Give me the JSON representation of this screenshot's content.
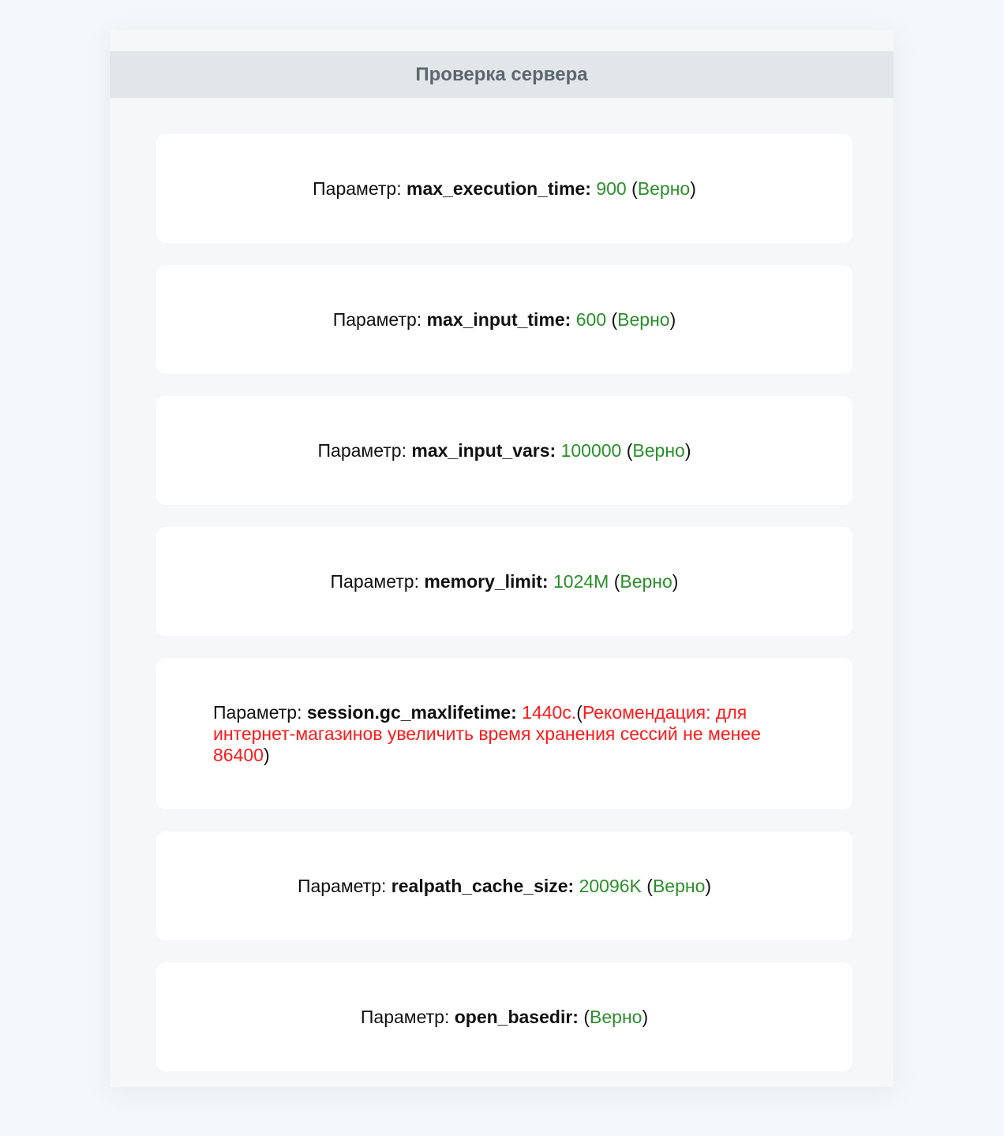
{
  "header": {
    "title": "Проверка сервера"
  },
  "checks": [
    {
      "prefix": "Параметр:",
      "name": "max_execution_time:",
      "value": "900",
      "status_open": "(",
      "status": "Верно",
      "status_close": ")"
    },
    {
      "prefix": "Параметр:",
      "name": "max_input_time:",
      "value": "600",
      "status_open": "(",
      "status": "Верно",
      "status_close": ")"
    },
    {
      "prefix": "Параметр:",
      "name": "max_input_vars:",
      "value": "100000",
      "status_open": "(",
      "status": "Верно",
      "status_close": ")"
    },
    {
      "prefix": "Параметр:",
      "name": "memory_limit:",
      "value": "1024M",
      "status_open": "(",
      "status": "Верно",
      "status_close": ")"
    },
    {
      "prefix": "Параметр:",
      "name": "session.gc_maxlifetime:",
      "value": "1440с.",
      "status_open": "(",
      "status": "Рекомендация: для интернет-магазинов увеличить время хранения сессий не менее 86400",
      "status_close": ")"
    },
    {
      "prefix": "Параметр:",
      "name": "realpath_cache_size:",
      "value": "20096K",
      "status_open": "(",
      "status": "Верно",
      "status_close": ")"
    },
    {
      "prefix": "Параметр:",
      "name": "open_basedir:",
      "value": "",
      "status_open": "(",
      "status": "Верно",
      "status_close": ")"
    }
  ],
  "colors": {
    "ok": "#2a8f2a",
    "warning": "#ff1a1a",
    "header_bg": "#e1e6e9",
    "panel_bg": "#f5f7f8"
  }
}
